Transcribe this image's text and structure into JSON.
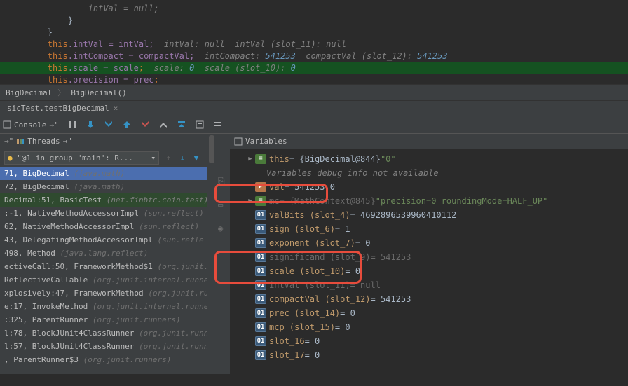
{
  "code": {
    "l0": "                intVal = null;",
    "l1": "            }",
    "l2": "        }",
    "l3_a": "this",
    "l3_b": ".intVal = intVal;",
    "l3_c": "  intVal: null  intVal (slot_11): null",
    "l4_a": "this",
    "l4_b": ".intCompact = compactVal;",
    "l4_c": "  intCompact: ",
    "l4_d": "541253",
    "l4_e": "  compactVal (slot_12): ",
    "l4_f": "541253",
    "l5_a": "this",
    "l5_b": ".scale = scale",
    "l5_c": ";",
    "l5_d": "  scale: ",
    "l5_e": "0",
    "l5_f": "  scale (slot_10): ",
    "l5_g": "0",
    "l6_a": "this",
    "l6_b": ".precision = prec",
    "l6_c": ";",
    "l7": "    }"
  },
  "breadcrumb": {
    "a": "BigDecimal",
    "b": "BigDecimal()"
  },
  "tab": {
    "label": "sicTest.testBigDecimal"
  },
  "toolbar": {
    "console": "Console"
  },
  "threads": {
    "header": "Threads",
    "select": "\"@1 in group \"main\": R..."
  },
  "frames": [
    {
      "m": "71, BigDecimal",
      "p": "(java.math)",
      "sel": true
    },
    {
      "m": "72, BigDecimal",
      "p": "(java.math)"
    },
    {
      "m": "Decimal:51, BasicTest",
      "p": "(net.finbtc.coin.test)",
      "hl": true
    },
    {
      "m": ":-1, NativeMethodAccessorImpl",
      "p": "(sun.reflect)"
    },
    {
      "m": "62, NativeMethodAccessorImpl",
      "p": "(sun.reflect)"
    },
    {
      "m": "43, DelegatingMethodAccessorImpl",
      "p": "(sun.refle"
    },
    {
      "m": "498, Method",
      "p": "(java.lang.reflect)"
    },
    {
      "m": "ectiveCall:50, FrameworkMethod$1",
      "p": "(org.junit."
    },
    {
      "m": "ReflectiveCallable",
      "p": "(org.junit.internal.runners.r"
    },
    {
      "m": "xplosively:47, FrameworkMethod",
      "p": "(org.junit.ru"
    },
    {
      "m": "e:17, InvokeMethod",
      "p": "(org.junit.internal.runners.s"
    },
    {
      "m": ":325, ParentRunner",
      "p": "(org.junit.runners)"
    },
    {
      "m": "l:78, BlockJUnit4ClassRunner",
      "p": "(org.junit.runn"
    },
    {
      "m": "l:57, BlockJUnit4ClassRunner",
      "p": "(org.junit.runn"
    },
    {
      "m": ", ParentRunner$3",
      "p": "(org.junit.runners)"
    }
  ],
  "vars": {
    "header": "Variables",
    "items": [
      {
        "arrow": "▶",
        "ic": "obj",
        "name": "this",
        "val": "= {BigDecimal@844}",
        "str": "\"0\""
      },
      {
        "arrow": "",
        "ic": "",
        "info": "Variables debug info not available"
      },
      {
        "arrow": "",
        "ic": "prim",
        "name": "val",
        "val": "= 541253.0"
      },
      {
        "arrow": "▶",
        "ic": "obj",
        "name": "mc",
        "val": "= {MathContext@845}",
        "str": "\"precision=0 roundingMode=HALF_UP\"",
        "dim": true
      },
      {
        "arrow": "",
        "ic": "arr",
        "name": "valBits (slot_4)",
        "val": "= 4692896539960410112"
      },
      {
        "arrow": "",
        "ic": "arr",
        "name": "sign (slot_6)",
        "val": "= 1"
      },
      {
        "arrow": "",
        "ic": "arr",
        "name": "exponent (slot_7)",
        "val": "= 0"
      },
      {
        "arrow": "",
        "ic": "arr",
        "name": "significand (slot_9)",
        "val": "= 541253",
        "dim": true
      },
      {
        "arrow": "",
        "ic": "arr",
        "name": "scale (slot_10)",
        "val": "= 0"
      },
      {
        "arrow": "",
        "ic": "arr",
        "name": "intVal (slot_11)",
        "val": "= null",
        "dim": true
      },
      {
        "arrow": "",
        "ic": "arr",
        "name": "compactVal (slot_12)",
        "val": "= 541253"
      },
      {
        "arrow": "",
        "ic": "arr",
        "name": "prec (slot_14)",
        "val": "= 0"
      },
      {
        "arrow": "",
        "ic": "arr",
        "name": "mcp (slot_15)",
        "val": "= 0"
      },
      {
        "arrow": "",
        "ic": "arr",
        "name": "slot_16",
        "val": "= 0"
      },
      {
        "arrow": "",
        "ic": "arr",
        "name": "slot_17",
        "val": "= 0"
      }
    ]
  }
}
